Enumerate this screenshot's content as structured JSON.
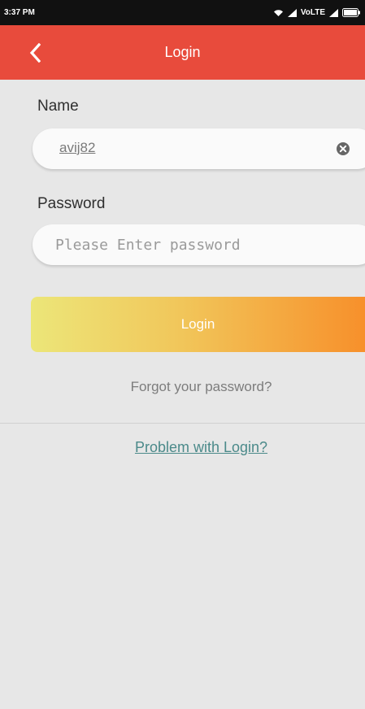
{
  "status_bar": {
    "time": "3:37 PM",
    "network_label": "VoLTE",
    "icons": [
      "wifi-icon",
      "signal-icon",
      "signal-icon",
      "battery-icon"
    ]
  },
  "app_bar": {
    "title": "Login",
    "back_icon": "chevron-left-icon"
  },
  "form": {
    "name_label": "Name",
    "name_value": "avij82",
    "clear_icon": "clear-icon",
    "password_label": "Password",
    "password_placeholder": "Please Enter password",
    "login_label": "Login"
  },
  "links": {
    "forgot": "Forgot your password?",
    "problem": "Problem with Login?"
  },
  "colors": {
    "app_bar": "#e84b3c",
    "background": "#e7e7e7",
    "button_gradient_start": "#ece679",
    "button_gradient_end": "#f7902b",
    "link": "#4b8a8a"
  }
}
